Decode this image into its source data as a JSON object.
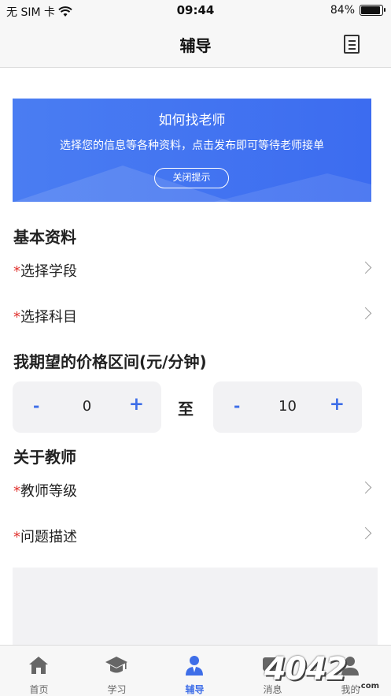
{
  "status_bar": {
    "carrier": "无 SIM 卡",
    "time": "09:44",
    "battery_text": "84%",
    "battery_level": 0.84
  },
  "nav": {
    "title": "辅导",
    "right_icon": "document-list-icon"
  },
  "banner": {
    "title": "如何找老师",
    "subtitle": "选择您的信息等各种资料，点击发布即可等待老师接单",
    "close_label": "关闭提示"
  },
  "basic_info": {
    "heading": "基本资料",
    "rows": [
      {
        "required": "*",
        "label": "选择学段"
      },
      {
        "required": "*",
        "label": "选择科目"
      }
    ]
  },
  "price": {
    "heading": "我期望的价格区间(元/分钟)",
    "min_value": "0",
    "max_value": "10",
    "separator": "至",
    "minus": "-",
    "plus": "+"
  },
  "teacher": {
    "heading": "关于教师",
    "rows": [
      {
        "required": "*",
        "label": "教师等级"
      },
      {
        "required": "*",
        "label": "问题描述"
      }
    ]
  },
  "tabs": [
    {
      "label": "首页",
      "icon": "home-icon"
    },
    {
      "label": "学习",
      "icon": "graduation-cap-icon"
    },
    {
      "label": "辅导",
      "icon": "tutor-person-icon",
      "active": true
    },
    {
      "label": "消息",
      "icon": "message-icon"
    },
    {
      "label": "我的",
      "icon": "profile-icon"
    }
  ],
  "watermark": {
    "text": "4042",
    "small": ".com"
  },
  "colors": {
    "accent": "#3e6ee8",
    "required": "#e0332f",
    "banner": "#4a7df2"
  }
}
